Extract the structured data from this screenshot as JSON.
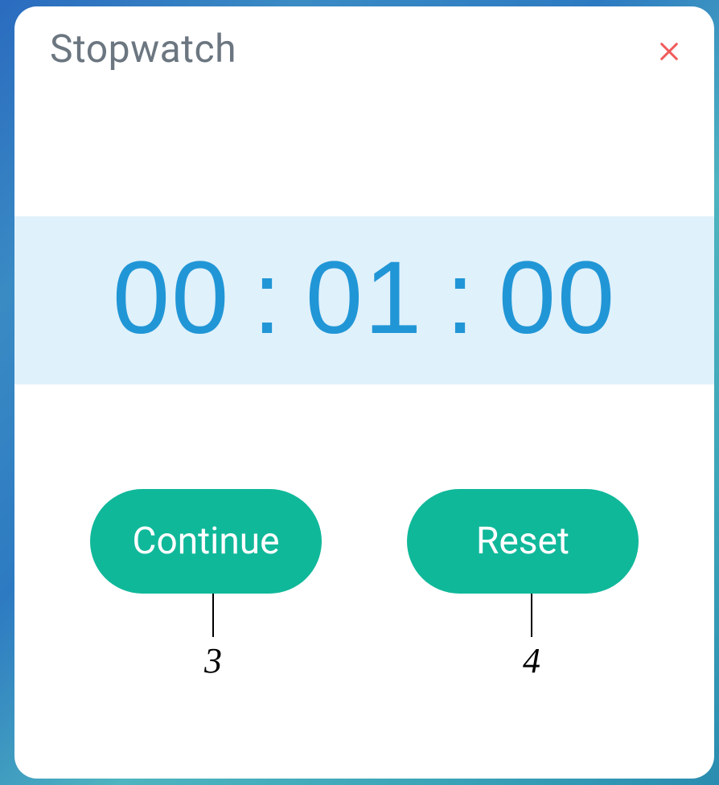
{
  "header": {
    "title": "Stopwatch"
  },
  "time": {
    "hours": "00",
    "minutes": "01",
    "seconds": "00",
    "sep": ":"
  },
  "buttons": {
    "continue": "Continue",
    "reset": "Reset"
  },
  "callouts": {
    "left": "3",
    "right": "4"
  }
}
